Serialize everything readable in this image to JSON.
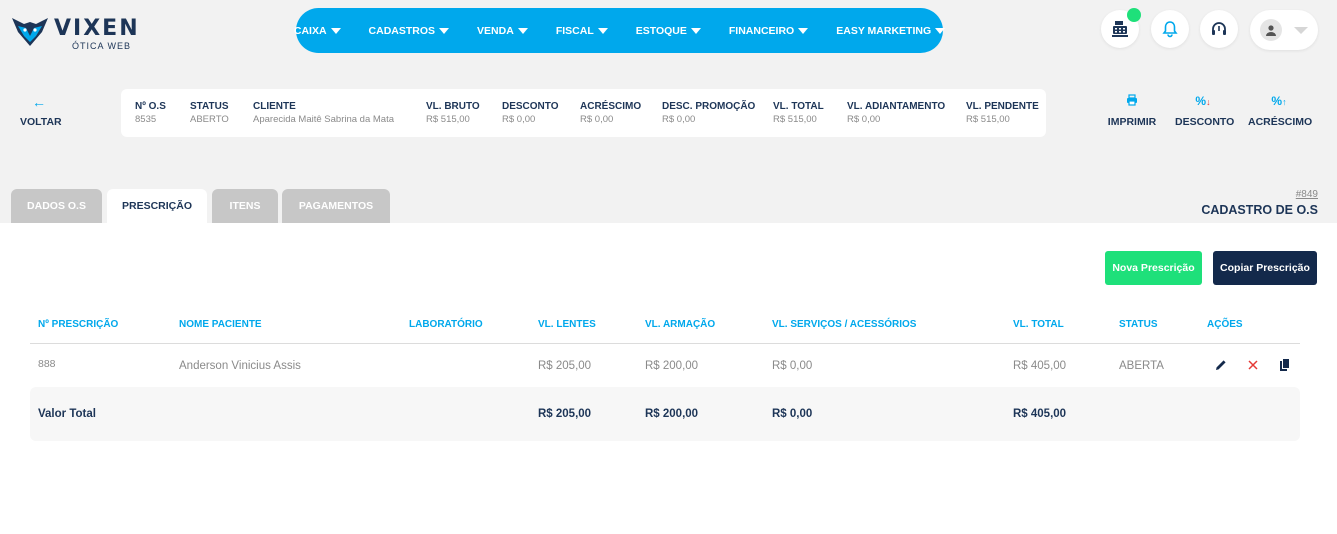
{
  "brand": {
    "name": "VIXEN",
    "sub": "ÓTICA WEB"
  },
  "nav": [
    {
      "label": "CAIXA"
    },
    {
      "label": "CADASTROS"
    },
    {
      "label": "VENDA"
    },
    {
      "label": "FISCAL"
    },
    {
      "label": "ESTOQUE"
    },
    {
      "label": "FINANCEIRO"
    },
    {
      "label": "EASY MARKETING"
    }
  ],
  "header_icons": [
    "cash-register-icon",
    "bell-icon",
    "headset-icon",
    "user-icon"
  ],
  "back": {
    "label": "VOLTAR"
  },
  "summary": [
    {
      "k": "Nº O.S",
      "v": "8535"
    },
    {
      "k": "STATUS",
      "v": "ABERTO"
    },
    {
      "k": "CLIENTE",
      "v": "Aparecida Maitê Sabrina da Mata"
    },
    {
      "k": "VL. BRUTO",
      "v": "R$ 515,00"
    },
    {
      "k": "DESCONTO",
      "v": "R$ 0,00"
    },
    {
      "k": "ACRÉSCIMO",
      "v": "R$ 0,00"
    },
    {
      "k": "DESC. PROMOÇÃO",
      "v": "R$ 0,00"
    },
    {
      "k": "VL. TOTAL",
      "v": "R$ 515,00"
    },
    {
      "k": "VL. ADIANTAMENTO",
      "v": "R$ 0,00"
    },
    {
      "k": "VL. PENDENTE",
      "v": "R$ 515,00"
    }
  ],
  "actions": [
    {
      "label": "IMPRIMIR"
    },
    {
      "label": "DESCONTO"
    },
    {
      "label": "ACRÉSCIMO"
    }
  ],
  "tabs": [
    {
      "label": "DADOS O.S"
    },
    {
      "label": "PRESCRIÇÃO"
    },
    {
      "label": "ITENS"
    },
    {
      "label": "PAGAMENTOS"
    }
  ],
  "page": {
    "os_id": "#849",
    "title": "CADASTRO DE O.S"
  },
  "buttons": {
    "new": "Nova Prescrição",
    "copy": "Copiar Prescrição"
  },
  "table": {
    "headers": [
      "Nº PRESCRIÇÃO",
      "NOME PACIENTE",
      "LABORATÓRIO",
      "VL. LENTES",
      "VL. ARMAÇÃO",
      "VL. SERVIÇOS / ACESSÓRIOS",
      "VL. TOTAL",
      "STATUS",
      "AÇÕES"
    ],
    "rows": [
      {
        "num": "888",
        "patient": "Anderson Vinicius Assis",
        "lab": "",
        "lenses": "R$ 205,00",
        "frame": "R$ 200,00",
        "services": "R$ 0,00",
        "total": "R$ 405,00",
        "status": "ABERTA"
      }
    ],
    "totals": {
      "label": "Valor Total",
      "lenses": "R$ 205,00",
      "frame": "R$ 200,00",
      "services": "R$ 0,00",
      "total": "R$ 405,00"
    }
  },
  "colors": {
    "accent": "#00a8ec",
    "dark": "#13294b",
    "green": "#1ee07a",
    "delete": "#e53935"
  }
}
